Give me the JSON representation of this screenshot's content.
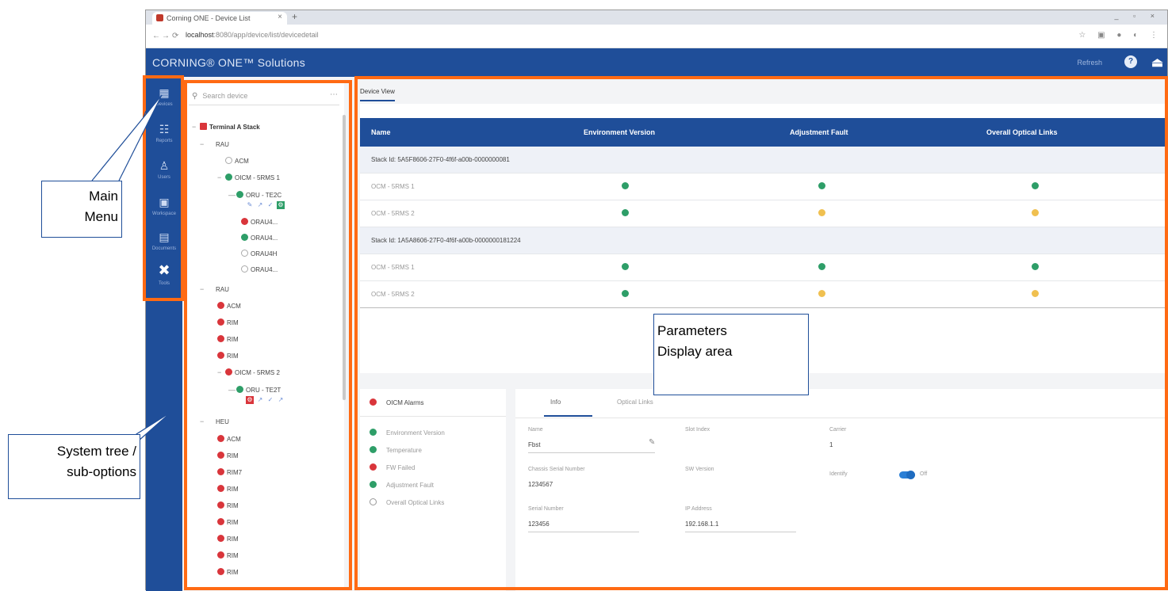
{
  "browser": {
    "tab_title": "Corning ONE - Device List",
    "tab_close": "×",
    "new_tab": "+",
    "window_controls": "_ ▫ ×",
    "nav_back": "←",
    "nav_forward": "→",
    "nav_reload": "⟳",
    "url_host": "localhost",
    "url_path": ":8080/app/device/list/devicedetail",
    "ext_icons": "☆ ▣ ● ◐ ⋮"
  },
  "app": {
    "brand": "CORNING® ONE™ Solutions",
    "user": "Refresh",
    "help_icon": "?",
    "exit_icon": "⏏"
  },
  "leftnav": {
    "items": [
      {
        "icon": "▦",
        "label": "Devices"
      },
      {
        "icon": "☷",
        "label": "Reports"
      },
      {
        "icon": "♙",
        "label": "Users"
      },
      {
        "icon": "▣",
        "label": "Workspace"
      },
      {
        "icon": "▤",
        "label": "Documents"
      },
      {
        "icon": "✖",
        "label": "Tools"
      }
    ]
  },
  "tree": {
    "search_placeholder": "Search device",
    "search_icon": "⚲",
    "more_icon": "⋯",
    "nodes": [
      {
        "label": "Terminal A Stack",
        "toggle": "−"
      },
      {
        "label": "RAU",
        "toggle": "−"
      },
      {
        "label": "ACM"
      },
      {
        "label": "OICM - 5RMS 1",
        "toggle": "−"
      },
      {
        "label": "ORU - TE2C",
        "toggle": "—"
      },
      {
        "label": "ORAU4..."
      },
      {
        "label": "ORAU4..."
      },
      {
        "label": "ORAU4H"
      },
      {
        "label": "ORAU4..."
      },
      {
        "label": "RAU",
        "toggle": "−"
      },
      {
        "label": "ACM"
      },
      {
        "label": "RIM"
      },
      {
        "label": "RIM"
      },
      {
        "label": "RIM"
      },
      {
        "label": "OICM - 5RMS 2",
        "toggle": "−"
      },
      {
        "label": "ORU - TE2T",
        "toggle": "—"
      },
      {
        "label": "HEU",
        "toggle": "−"
      },
      {
        "label": "ACM"
      },
      {
        "label": "RIM"
      },
      {
        "label": "RIM7"
      },
      {
        "label": "RIM"
      },
      {
        "label": "RIM"
      },
      {
        "label": "RIM"
      },
      {
        "label": "RIM"
      },
      {
        "label": "RIM"
      },
      {
        "label": "RIM"
      }
    ],
    "tool_icons_1": [
      "✎",
      "↗",
      "✓",
      "⚙"
    ],
    "tool_icons_2": [
      "⚙",
      "↗",
      "✓",
      "↗"
    ]
  },
  "main": {
    "tab": "Device View",
    "columns": [
      "Name",
      "Environment Version",
      "Adjustment Fault",
      "Overall Optical Links"
    ],
    "groups": [
      {
        "title": "Stack Id: 5A5F8606-27F0-4f6f-a00b-0000000081",
        "rows": [
          {
            "name": "OCM - 5RMS 1",
            "c1": "green",
            "c2": "green",
            "c3": "green"
          },
          {
            "name": "OCM - 5RMS 2",
            "c1": "green",
            "c2": "yellow",
            "c3": "yellow"
          }
        ]
      },
      {
        "title": "Stack Id: 1A5A8606-27F0-4f6f-a00b-0000000181224",
        "rows": [
          {
            "name": "OCM - 5RMS 1",
            "c1": "green",
            "c2": "green",
            "c3": "green"
          },
          {
            "name": "OCM - 5RMS 2",
            "c1": "green",
            "c2": "yellow",
            "c3": "yellow"
          }
        ]
      }
    ],
    "alarms": {
      "title": "OICM Alarms",
      "items": [
        {
          "label": "Environment Version",
          "color": "green"
        },
        {
          "label": "Temperature",
          "color": "green"
        },
        {
          "label": "FW Failed",
          "color": "red"
        },
        {
          "label": "Adjustment Fault",
          "color": "green"
        },
        {
          "label": "Overall Optical Links",
          "color": "empty"
        }
      ]
    },
    "info": {
      "tabs": [
        "Info",
        "Optical Links"
      ],
      "fields": [
        {
          "label": "Name",
          "value": "Fbst"
        },
        {
          "label": "Slot Index",
          "value": ""
        },
        {
          "label": "Carrier",
          "value": "1"
        },
        {
          "label": "Chassis Serial Number",
          "value": "1234567"
        },
        {
          "label": "SW Version",
          "value": ""
        },
        {
          "label": "Identify",
          "value": "Off"
        },
        {
          "label": "Serial Number",
          "value": "123456"
        },
        {
          "label": "IP Address",
          "value": "192.168.1.1"
        }
      ],
      "edit_icon": "✎"
    }
  },
  "annotations": {
    "main_menu": "Main\nMenu",
    "system_tree": "System tree /\nsub-options",
    "params": "Parameters\nDisplay area"
  },
  "colors": {
    "brand_blue": "#1f4e99",
    "highlight_orange": "#ff6a13",
    "status_green": "#2e9e68",
    "status_yellow": "#f0c050",
    "status_red": "#d9353b"
  }
}
